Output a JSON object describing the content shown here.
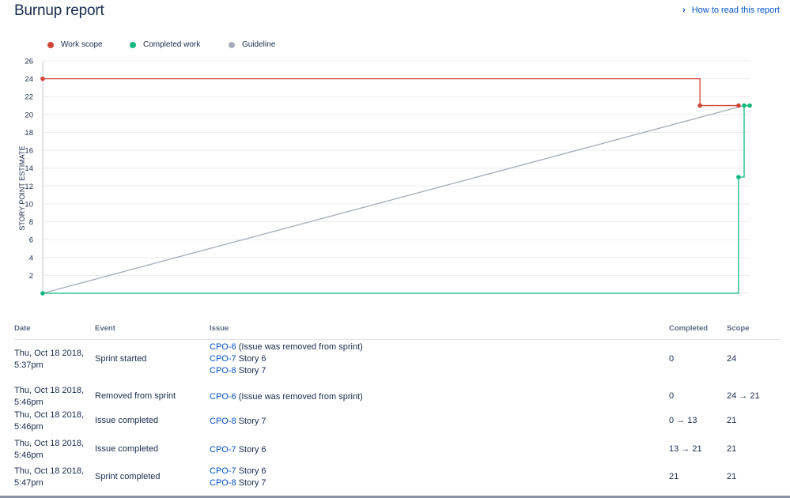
{
  "header": {
    "title": "Burnup report",
    "help_link": "How to read this report",
    "help_icon": "chevron-right-icon"
  },
  "legend": [
    {
      "label": "Work scope",
      "color": "#d04437"
    },
    {
      "label": "Completed work",
      "color": "#14b87c"
    },
    {
      "label": "Guideline",
      "color": "#a5adba"
    }
  ],
  "chart_data": {
    "type": "line",
    "title": "",
    "xlabel": "",
    "ylabel": "STORY POINT ESTIMATE",
    "ylim": [
      0,
      26
    ],
    "yticks": [
      2,
      4,
      6,
      8,
      10,
      12,
      14,
      16,
      18,
      20,
      22,
      24,
      26
    ],
    "x_axis": "time",
    "grid": true,
    "series": [
      {
        "name": "Work scope",
        "color": "#d04437",
        "step": true,
        "points": [
          [
            0,
            24
          ],
          [
            0.937,
            24
          ],
          [
            0.937,
            21
          ],
          [
            0.992,
            21
          ]
        ],
        "markers": [
          [
            0,
            24
          ],
          [
            0.937,
            21
          ],
          [
            0.992,
            21
          ]
        ]
      },
      {
        "name": "Completed work",
        "color": "#14b87c",
        "step": true,
        "points": [
          [
            0,
            0
          ],
          [
            0.992,
            0
          ],
          [
            0.992,
            13
          ],
          [
            1.0,
            13
          ],
          [
            1.0,
            21
          ],
          [
            1.008,
            21
          ]
        ],
        "markers": [
          [
            0,
            0
          ],
          [
            0.992,
            13
          ],
          [
            1.0,
            21
          ],
          [
            1.008,
            21
          ]
        ]
      },
      {
        "name": "Guideline",
        "color": "#a5adba",
        "step": false,
        "points": [
          [
            0,
            0
          ],
          [
            1.0,
            21
          ]
        ],
        "markers": []
      }
    ]
  },
  "table": {
    "columns": {
      "date": "Date",
      "event": "Event",
      "issue": "Issue",
      "completed": "Completed",
      "scope": "Scope"
    },
    "rows": [
      {
        "date": [
          "Thu, Oct 18 2018,",
          "5:37pm"
        ],
        "event": "Sprint started",
        "issues": [
          {
            "key": "CPO-6",
            "text": "(Issue was removed from sprint)"
          },
          {
            "key": "CPO-7",
            "text": "Story 6"
          },
          {
            "key": "CPO-8",
            "text": "Story 7"
          }
        ],
        "completed": "0",
        "scope": "24"
      },
      {
        "date": [
          "Thu, Oct 18 2018,",
          "5:46pm"
        ],
        "event": "Removed from sprint",
        "issues": [
          {
            "key": "CPO-6",
            "text": "(Issue was removed from sprint)"
          }
        ],
        "completed": "0",
        "scope": "24 → 21"
      },
      {
        "date": [
          "Thu, Oct 18 2018,",
          "5:46pm"
        ],
        "event": "Issue completed",
        "issues": [
          {
            "key": "CPO-8",
            "text": "Story 7"
          }
        ],
        "completed": "0 → 13",
        "scope": "21"
      },
      {
        "date": [
          "Thu, Oct 18 2018,",
          "5:46pm"
        ],
        "event": "Issue completed",
        "issues": [
          {
            "key": "CPO-7",
            "text": "Story 6"
          }
        ],
        "completed": "13 → 21",
        "scope": "21"
      },
      {
        "date": [
          "Thu, Oct 18 2018,",
          "5:47pm"
        ],
        "event": "Sprint completed",
        "issues": [
          {
            "key": "CPO-7",
            "text": "Story 6"
          },
          {
            "key": "CPO-8",
            "text": "Story 7"
          }
        ],
        "completed": "21",
        "scope": "21"
      }
    ]
  }
}
